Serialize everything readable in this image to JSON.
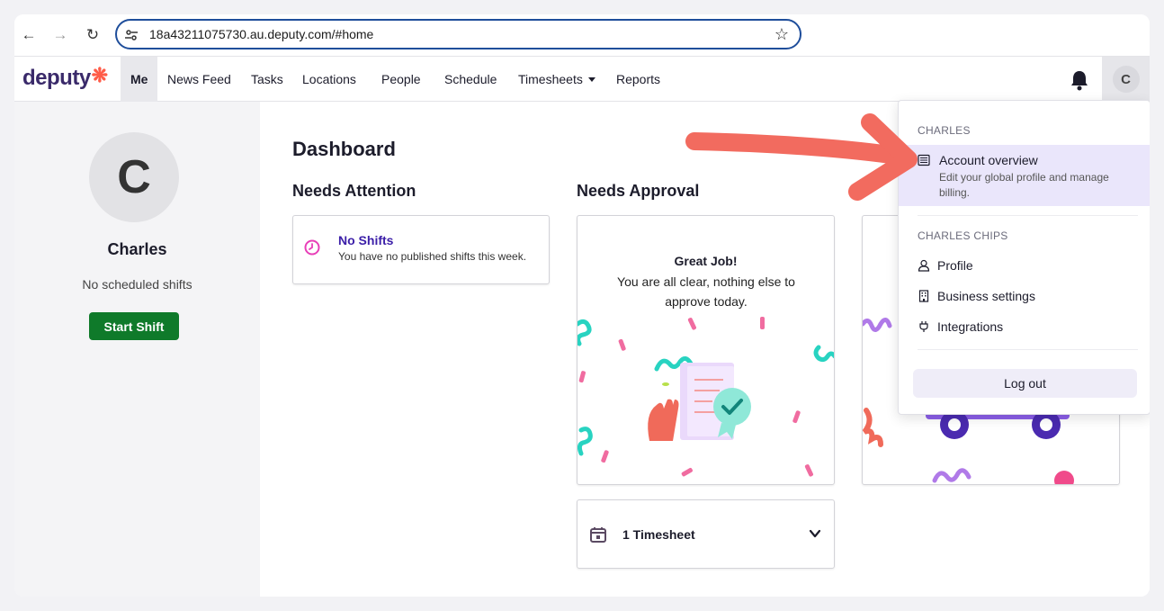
{
  "browser": {
    "url": "18a43211075730.au.deputy.com/#home"
  },
  "app": {
    "logo_text": "deputy",
    "nav": {
      "me": "Me",
      "news_feed": "News Feed",
      "tasks": "Tasks",
      "locations": "Locations",
      "people": "People",
      "schedule": "Schedule",
      "timesheets": "Timesheets",
      "reports": "Reports"
    },
    "avatar_initial": "C"
  },
  "sidebar": {
    "avatar_initial": "C",
    "name": "Charles",
    "status": "No scheduled shifts",
    "start_shift": "Start Shift"
  },
  "dashboard": {
    "title": "Dashboard",
    "needs_attention": {
      "title": "Needs Attention",
      "card_title": "No Shifts",
      "card_text": "You have no published shifts this week."
    },
    "needs_approval": {
      "title": "Needs Approval",
      "headline": "Great Job!",
      "message": "You are all clear, nothing else to approve today."
    },
    "timesheet": {
      "label": "1 Timesheet"
    }
  },
  "dropdown": {
    "section_user": "CHARLES",
    "account_overview": {
      "title": "Account overview",
      "desc": "Edit your global profile and manage billing."
    },
    "section_business": "CHARLES CHIPS",
    "items": {
      "profile": "Profile",
      "business_settings": "Business settings",
      "integrations": "Integrations"
    },
    "logout": "Log out"
  },
  "colors": {
    "brand_purple": "#3b1ea8",
    "start_green": "#0f7a2a",
    "annotation_arrow": "#f26b5f",
    "highlight": "#eae6fb"
  }
}
